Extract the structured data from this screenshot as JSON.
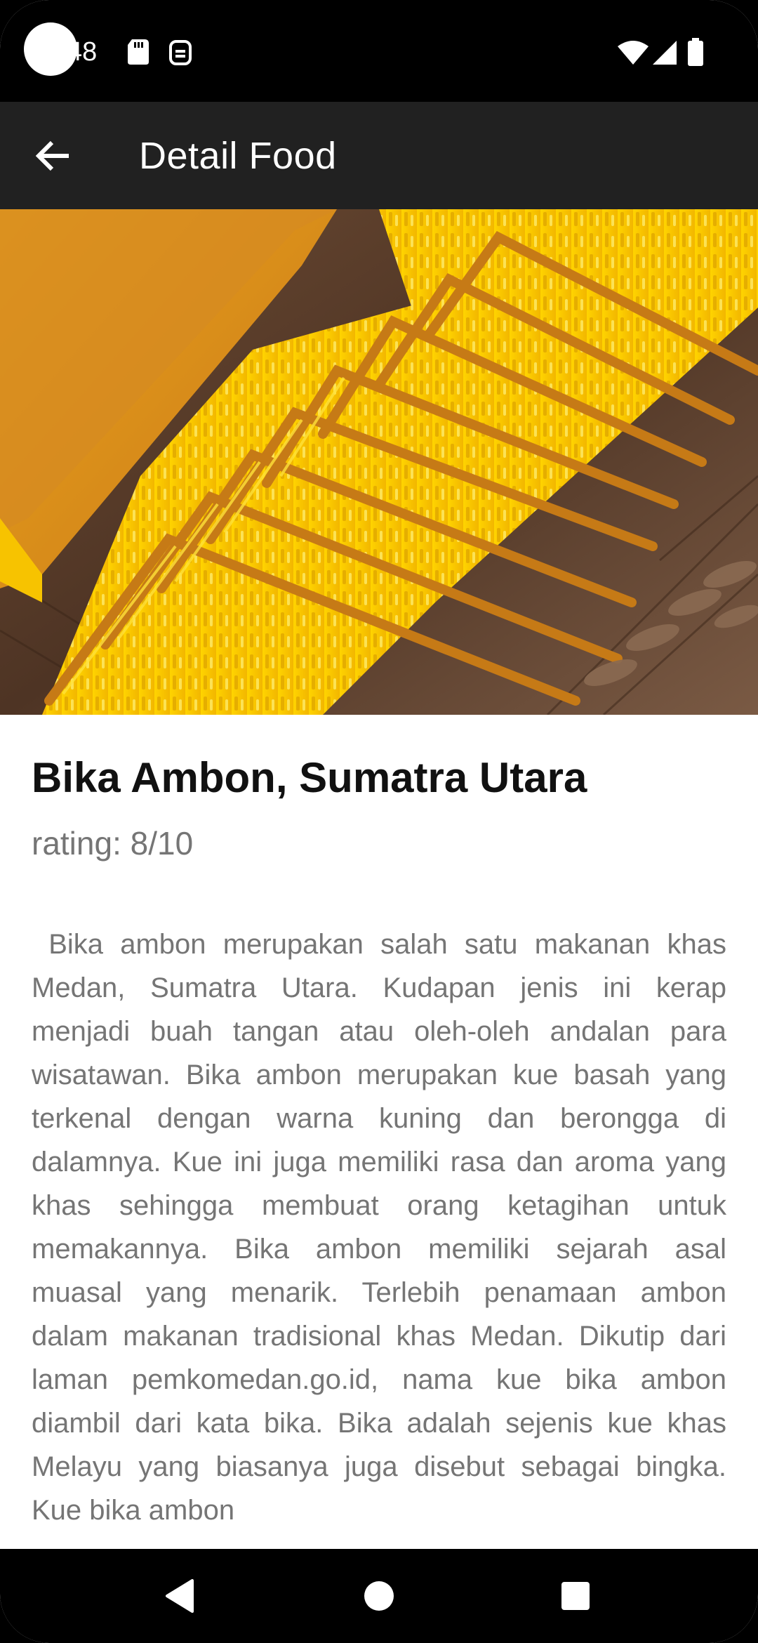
{
  "status_bar": {
    "time": "48",
    "icons": [
      "sd-card-icon",
      "app-notification-icon",
      "wifi-icon",
      "signal-icon",
      "battery-icon"
    ]
  },
  "app_bar": {
    "title": "Detail Food",
    "back_icon": "arrow-back-icon"
  },
  "hero_image": {
    "subject": "Bika Ambon cake slices"
  },
  "food": {
    "title": "Bika Ambon, Sumatra Utara",
    "rating": "rating: 8/10",
    "description": " Bika ambon merupakan salah satu makanan khas Medan, Sumatra Utara. Kudapan jenis ini kerap menjadi buah tangan atau oleh-oleh andalan para wisatawan. Bika ambon merupakan kue basah yang terkenal dengan warna kuning dan berongga di dalamnya. Kue ini juga memiliki rasa dan aroma yang khas sehingga membuat orang ketagihan untuk memakannya. Bika ambon memiliki sejarah asal muasal yang menarik. Terlebih penamaan ambon dalam makanan tradisional khas Medan. Dikutip dari laman pemkomedan.go.id, nama kue bika ambon diambil dari kata bika. Bika adalah sejenis kue khas Melayu yang biasanya juga disebut sebagai bingka. Kue bika ambon"
  },
  "nav_bar": {
    "icons": [
      "back-triangle-icon",
      "home-circle-icon",
      "recents-square-icon"
    ]
  },
  "colors": {
    "status_bar": "#000000",
    "app_bar": "#212121",
    "title_text": "#111111",
    "secondary_text": "#757575",
    "cake_yellow": "#f5c400"
  }
}
